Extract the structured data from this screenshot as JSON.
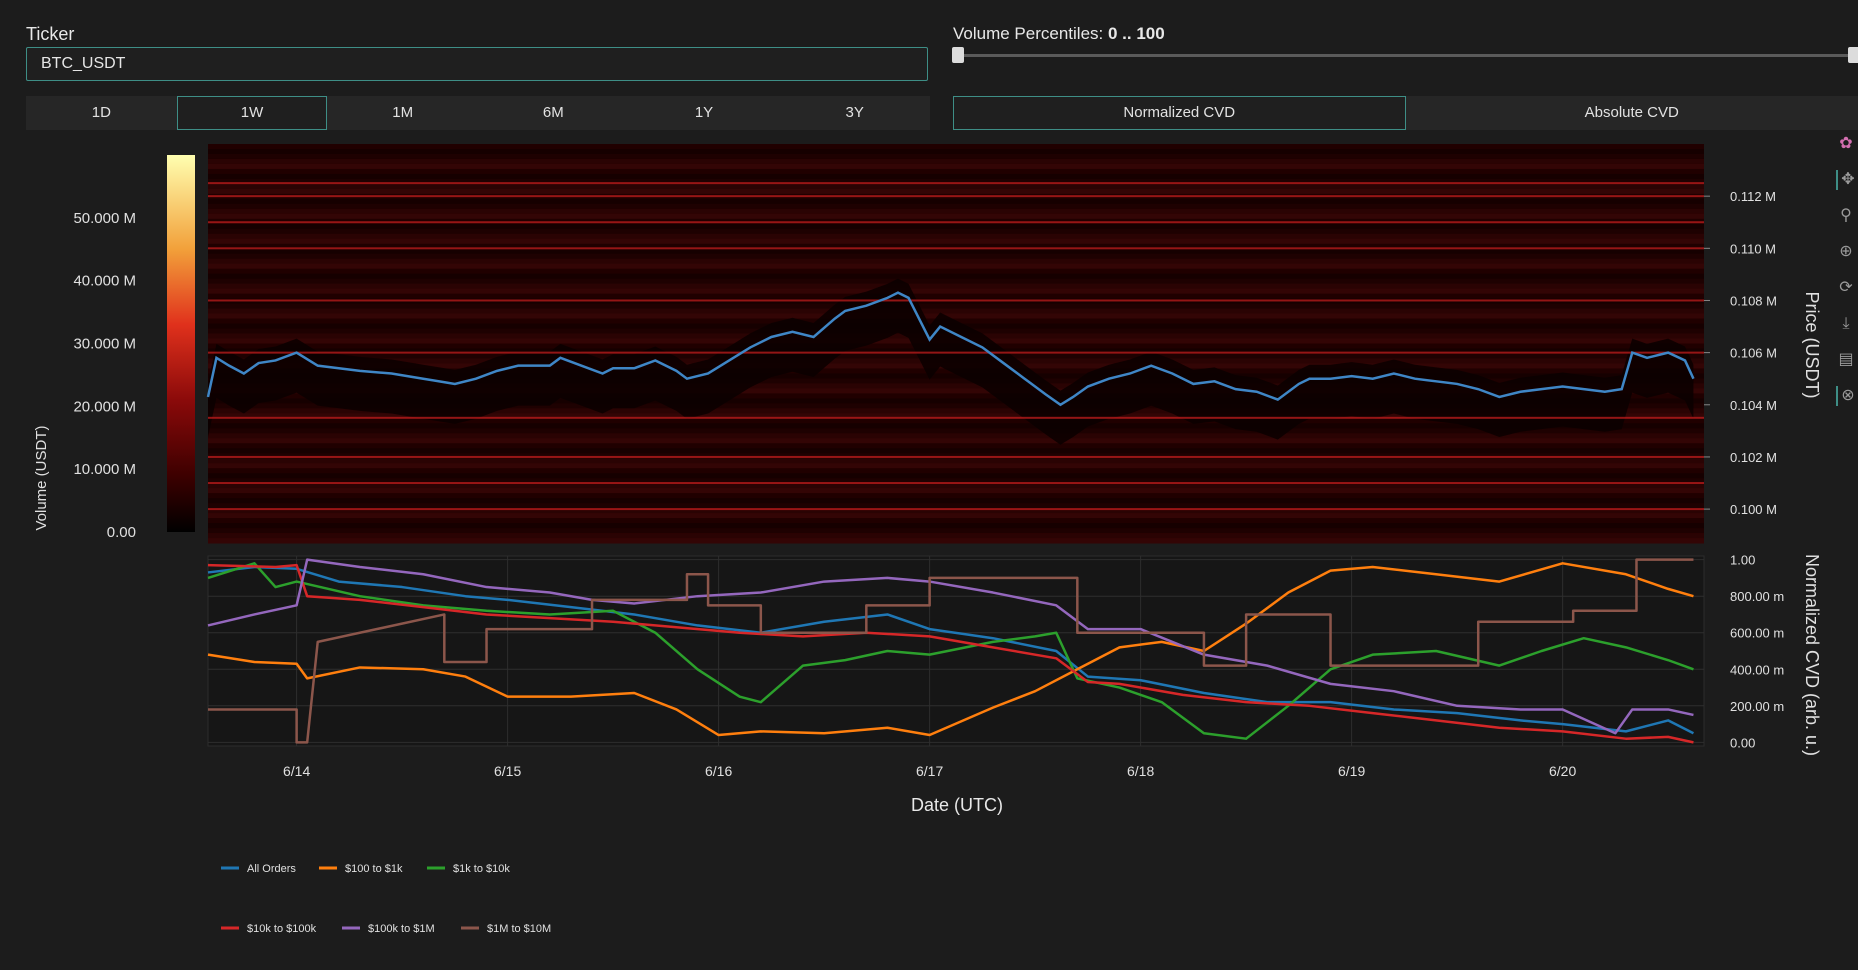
{
  "ticker": {
    "label": "Ticker",
    "value": "BTC_USDT"
  },
  "volume_percentiles": {
    "label": "Volume Percentiles:",
    "range_text": "0 .. 100",
    "low": 0,
    "high": 100
  },
  "range_buttons": [
    {
      "label": "1D",
      "active": false
    },
    {
      "label": "1W",
      "active": true
    },
    {
      "label": "1M",
      "active": false
    },
    {
      "label": "6M",
      "active": false
    },
    {
      "label": "1Y",
      "active": false
    },
    {
      "label": "3Y",
      "active": false
    }
  ],
  "cvd_buttons": [
    {
      "label": "Normalized CVD",
      "active": true
    },
    {
      "label": "Absolute CVD",
      "active": false
    }
  ],
  "modebar": [
    {
      "name": "plotly-logo-icon",
      "glyph": "✿"
    },
    {
      "name": "pan-icon",
      "glyph": "✥"
    },
    {
      "name": "zoom-icon",
      "glyph": "⚲"
    },
    {
      "name": "zoom-in-icon",
      "glyph": "⊕"
    },
    {
      "name": "autoscale-icon",
      "glyph": "⟳"
    },
    {
      "name": "download-icon",
      "glyph": "⤓"
    },
    {
      "name": "compare-hover-icon",
      "glyph": "▤"
    },
    {
      "name": "spike-lines-icon",
      "glyph": "⊗"
    }
  ],
  "colors": {
    "accent": "#3e8e86",
    "all_orders": "#1f77b4",
    "s100_1k": "#ff7f0e",
    "s1k_10k": "#2ca02c",
    "s10k_100k": "#d62728",
    "s100k_1m": "#9467bd",
    "s1m_10m": "#8c564b",
    "price_line": "#3f86c6"
  },
  "chart_data": [
    {
      "type": "heatmap",
      "title": "",
      "xlabel": "Date (UTC)",
      "ylabel": "Price (USDT)",
      "colorbar_label": "Volume (USDT)",
      "colorbar_ticks": [
        "0.00",
        "10.000 M",
        "20.000 M",
        "30.000 M",
        "40.000 M",
        "50.000 M"
      ],
      "colorbar_values": [
        0,
        10,
        20,
        30,
        40,
        50
      ],
      "colorbar_range": [
        0,
        60
      ],
      "y_ticks": [
        "0.100 M",
        "0.102 M",
        "0.104 M",
        "0.106 M",
        "0.108 M",
        "0.110 M",
        "0.112 M"
      ],
      "y_tick_values": [
        0.1,
        0.102,
        0.104,
        0.106,
        0.108,
        0.11,
        0.112
      ],
      "ylim": [
        0.0987,
        0.114
      ],
      "xlim": [
        13.58,
        20.67
      ],
      "bright_levels": [
        0.1,
        0.101,
        0.102,
        0.1035,
        0.106,
        0.108,
        0.11,
        0.111,
        0.112,
        0.1125
      ],
      "price_series": {
        "x": [
          13.58,
          13.62,
          13.68,
          13.75,
          13.82,
          13.9,
          14.0,
          14.1,
          14.2,
          14.3,
          14.45,
          14.6,
          14.75,
          14.85,
          14.95,
          15.05,
          15.2,
          15.25,
          15.35,
          15.45,
          15.5,
          15.6,
          15.7,
          15.8,
          15.85,
          15.95,
          16.05,
          16.15,
          16.25,
          16.35,
          16.45,
          16.55,
          16.6,
          16.7,
          16.8,
          16.85,
          16.9,
          16.95,
          17.0,
          17.05,
          17.15,
          17.25,
          17.35,
          17.45,
          17.55,
          17.62,
          17.68,
          17.75,
          17.85,
          17.95,
          18.05,
          18.15,
          18.25,
          18.35,
          18.45,
          18.55,
          18.65,
          18.75,
          18.8,
          18.9,
          19.0,
          19.1,
          19.2,
          19.3,
          19.4,
          19.5,
          19.6,
          19.7,
          19.8,
          19.9,
          20.0,
          20.1,
          20.2,
          20.28,
          20.33,
          20.4,
          20.5,
          20.58,
          20.62
        ],
        "y": [
          0.1043,
          0.1058,
          0.1055,
          0.1052,
          0.1056,
          0.1057,
          0.106,
          0.1055,
          0.1054,
          0.1053,
          0.1052,
          0.105,
          0.1048,
          0.105,
          0.1053,
          0.1055,
          0.1055,
          0.1058,
          0.1055,
          0.1052,
          0.1054,
          0.1054,
          0.1057,
          0.1053,
          0.105,
          0.1052,
          0.1057,
          0.1062,
          0.1066,
          0.1068,
          0.1066,
          0.1073,
          0.1076,
          0.1078,
          0.1081,
          0.1083,
          0.1081,
          0.1073,
          0.1065,
          0.107,
          0.1066,
          0.1062,
          0.1056,
          0.105,
          0.1044,
          0.104,
          0.1043,
          0.1047,
          0.105,
          0.1052,
          0.1055,
          0.1052,
          0.1048,
          0.1049,
          0.1046,
          0.1045,
          0.1042,
          0.1048,
          0.105,
          0.105,
          0.1051,
          0.105,
          0.1052,
          0.105,
          0.1049,
          0.1048,
          0.1046,
          0.1043,
          0.1045,
          0.1046,
          0.1047,
          0.1046,
          0.1045,
          0.1046,
          0.106,
          0.1058,
          0.106,
          0.1057,
          0.105
        ]
      }
    },
    {
      "type": "line",
      "title": "",
      "xlabel": "Date (UTC)",
      "ylabel": "Normalized CVD (arb. u.)",
      "x_ticks": [
        "6/14",
        "6/15",
        "6/16",
        "6/17",
        "6/18",
        "6/19",
        "6/20"
      ],
      "x_tick_values": [
        14,
        15,
        16,
        17,
        18,
        19,
        20
      ],
      "xlim": [
        13.58,
        20.67
      ],
      "y_ticks": [
        "0.00",
        "200.00 m",
        "400.00 m",
        "600.00 m",
        "800.00 m",
        "1.00"
      ],
      "y_tick_values": [
        0,
        0.2,
        0.4,
        0.6,
        0.8,
        1.0
      ],
      "ylim": [
        -0.02,
        1.02
      ],
      "legend_position": "bottom-left",
      "series": [
        {
          "name": "All Orders",
          "color_key": "all_orders",
          "x": [
            13.58,
            13.8,
            14.0,
            14.2,
            14.5,
            14.8,
            15.0,
            15.3,
            15.6,
            15.9,
            16.2,
            16.5,
            16.8,
            17.0,
            17.3,
            17.6,
            17.75,
            18.0,
            18.3,
            18.6,
            18.9,
            19.2,
            19.5,
            19.8,
            20.0,
            20.3,
            20.5,
            20.62
          ],
          "y": [
            0.93,
            0.96,
            0.95,
            0.88,
            0.85,
            0.8,
            0.78,
            0.74,
            0.7,
            0.64,
            0.6,
            0.66,
            0.7,
            0.62,
            0.57,
            0.5,
            0.36,
            0.34,
            0.27,
            0.22,
            0.22,
            0.18,
            0.16,
            0.12,
            0.1,
            0.06,
            0.12,
            0.05
          ]
        },
        {
          "name": "$100 to $1k",
          "color_key": "s100_1k",
          "x": [
            13.58,
            13.8,
            14.0,
            14.05,
            14.3,
            14.6,
            14.8,
            15.0,
            15.3,
            15.6,
            15.8,
            16.0,
            16.2,
            16.5,
            16.8,
            17.0,
            17.3,
            17.5,
            17.7,
            17.9,
            18.1,
            18.3,
            18.5,
            18.7,
            18.9,
            19.1,
            19.4,
            19.7,
            20.0,
            20.3,
            20.5,
            20.62
          ],
          "y": [
            0.48,
            0.44,
            0.43,
            0.35,
            0.41,
            0.4,
            0.36,
            0.25,
            0.25,
            0.27,
            0.18,
            0.04,
            0.06,
            0.05,
            0.08,
            0.04,
            0.19,
            0.28,
            0.4,
            0.52,
            0.55,
            0.5,
            0.65,
            0.82,
            0.94,
            0.96,
            0.92,
            0.88,
            0.98,
            0.92,
            0.84,
            0.8
          ]
        },
        {
          "name": "$1k to $10k",
          "color_key": "s1k_10k",
          "x": [
            13.58,
            13.8,
            13.9,
            14.0,
            14.3,
            14.6,
            14.9,
            15.2,
            15.5,
            15.7,
            15.9,
            16.1,
            16.2,
            16.4,
            16.6,
            16.8,
            17.0,
            17.3,
            17.5,
            17.6,
            17.7,
            17.9,
            18.1,
            18.3,
            18.5,
            18.7,
            18.9,
            19.1,
            19.4,
            19.7,
            19.9,
            20.1,
            20.3,
            20.5,
            20.62
          ],
          "y": [
            0.9,
            0.98,
            0.85,
            0.88,
            0.8,
            0.75,
            0.72,
            0.7,
            0.72,
            0.6,
            0.4,
            0.25,
            0.22,
            0.42,
            0.45,
            0.5,
            0.48,
            0.55,
            0.58,
            0.6,
            0.35,
            0.3,
            0.22,
            0.05,
            0.02,
            0.2,
            0.4,
            0.48,
            0.5,
            0.42,
            0.5,
            0.57,
            0.52,
            0.45,
            0.4
          ]
        },
        {
          "name": "$10k to $100k",
          "color_key": "s10k_100k",
          "x": [
            13.58,
            13.9,
            14.0,
            14.05,
            14.3,
            14.6,
            14.9,
            15.2,
            15.5,
            15.8,
            16.1,
            16.4,
            16.7,
            17.0,
            17.3,
            17.6,
            17.75,
            17.9,
            18.2,
            18.5,
            18.8,
            19.1,
            19.4,
            19.7,
            20.0,
            20.3,
            20.5,
            20.62
          ],
          "y": [
            0.97,
            0.96,
            0.97,
            0.8,
            0.78,
            0.74,
            0.7,
            0.68,
            0.66,
            0.63,
            0.6,
            0.58,
            0.6,
            0.58,
            0.52,
            0.46,
            0.33,
            0.32,
            0.26,
            0.22,
            0.2,
            0.16,
            0.12,
            0.08,
            0.06,
            0.02,
            0.03,
            0.0
          ]
        },
        {
          "name": "$100k to $1M",
          "color_key": "s100k_1m",
          "x": [
            13.58,
            13.8,
            14.0,
            14.05,
            14.3,
            14.6,
            14.9,
            15.2,
            15.4,
            15.6,
            15.9,
            16.2,
            16.5,
            16.8,
            17.0,
            17.3,
            17.6,
            17.75,
            18.0,
            18.3,
            18.6,
            18.9,
            19.2,
            19.5,
            19.8,
            20.0,
            20.25,
            20.33,
            20.5,
            20.62
          ],
          "y": [
            0.64,
            0.7,
            0.75,
            1.0,
            0.96,
            0.92,
            0.85,
            0.82,
            0.78,
            0.76,
            0.8,
            0.82,
            0.88,
            0.9,
            0.88,
            0.82,
            0.75,
            0.62,
            0.62,
            0.48,
            0.42,
            0.32,
            0.28,
            0.2,
            0.18,
            0.18,
            0.05,
            0.18,
            0.18,
            0.15
          ]
        },
        {
          "name": "$1M to $10M",
          "color_key": "s1m_10m",
          "x": [
            13.58,
            14.0,
            14.0,
            14.05,
            14.1,
            14.1,
            14.7,
            14.7,
            14.9,
            14.9,
            15.4,
            15.4,
            15.85,
            15.85,
            15.95,
            15.95,
            16.2,
            16.2,
            16.7,
            16.7,
            17.0,
            17.0,
            17.15,
            17.15,
            17.7,
            17.7,
            18.3,
            18.3,
            18.5,
            18.5,
            18.9,
            18.9,
            19.6,
            19.6,
            20.05,
            20.05,
            20.35,
            20.35,
            20.62
          ],
          "y": [
            0.18,
            0.18,
            0.0,
            0.0,
            0.55,
            0.55,
            0.7,
            0.44,
            0.44,
            0.62,
            0.62,
            0.78,
            0.78,
            0.92,
            0.92,
            0.75,
            0.75,
            0.6,
            0.6,
            0.75,
            0.75,
            0.9,
            0.9,
            0.9,
            0.9,
            0.6,
            0.6,
            0.42,
            0.42,
            0.7,
            0.7,
            0.42,
            0.42,
            0.66,
            0.66,
            0.72,
            0.72,
            1.0,
            1.0
          ]
        }
      ]
    }
  ]
}
